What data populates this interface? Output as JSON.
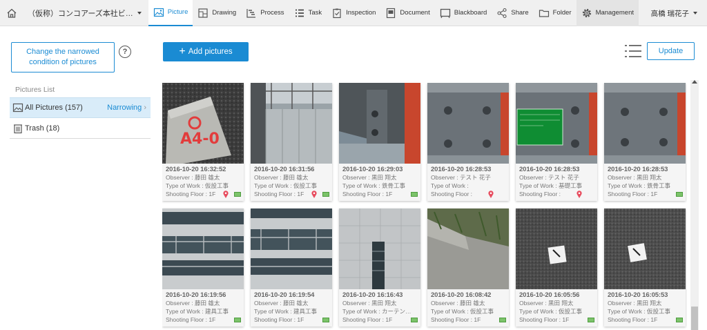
{
  "header": {
    "project_name": "（仮称）コンコアーズ本社ビ…",
    "nav": [
      {
        "label": "Picture",
        "icon": "picture-icon"
      },
      {
        "label": "Drawing",
        "icon": "drawing-icon"
      },
      {
        "label": "Process",
        "icon": "process-icon"
      },
      {
        "label": "Task",
        "icon": "task-icon"
      },
      {
        "label": "Inspection",
        "icon": "inspection-icon"
      },
      {
        "label": "Document",
        "icon": "document-icon"
      },
      {
        "label": "Blackboard",
        "icon": "blackboard-icon"
      },
      {
        "label": "Share",
        "icon": "share-icon"
      },
      {
        "label": "Folder",
        "icon": "folder-icon"
      },
      {
        "label": "Management",
        "icon": "gear-icon"
      }
    ],
    "user_name": "高橋 瑞花子"
  },
  "sidebar": {
    "narrow_button": "Change the narrowed condition of pictures",
    "help": "?",
    "list_title": "Pictures List",
    "all_pictures": "All Pictures (157)",
    "narrowing": "Narrowing",
    "trash": "Trash (18)"
  },
  "toolbar": {
    "add_label": "Add pictures",
    "update_label": "Update"
  },
  "colors": {
    "accent": "#1a8bd3",
    "pin": "#e74c5e",
    "board": "#7cc36a"
  },
  "pictures": [
    {
      "datetime": "2016-10-20 16:32:52",
      "observer": "Observer : 藤田 雄太",
      "work": "Type of Work : 仮設工事",
      "floor": "Shooting Floor : 1F",
      "pin": true,
      "board": true
    },
    {
      "datetime": "2016-10-20 16:31:56",
      "observer": "Observer : 藤田 雄太",
      "work": "Type of Work : 仮設工事",
      "floor": "Shooting Floor : 1F",
      "pin": true,
      "board": true
    },
    {
      "datetime": "2016-10-20 16:29:03",
      "observer": "Observer : 黒田 翔太",
      "work": "Type of Work : 鉄骨工事",
      "floor": "Shooting Floor : 1F",
      "pin": false,
      "board": true
    },
    {
      "datetime": "2016-10-20 16:28:53",
      "observer": "Observer : テスト 花子",
      "work": "Type of Work :",
      "floor": "Shooting Floor :",
      "pin": true,
      "board": false
    },
    {
      "datetime": "2016-10-20 16:28:53",
      "observer": "Observer : テスト 花子",
      "work": "Type of Work : 基礎工事",
      "floor": "Shooting Floor :",
      "pin": true,
      "board": false
    },
    {
      "datetime": "2016-10-20 16:28:53",
      "observer": "Observer : 黒田 翔太",
      "work": "Type of Work : 鉄骨工事",
      "floor": "Shooting Floor : 1F",
      "pin": false,
      "board": true
    },
    {
      "datetime": "2016-10-20 16:19:56",
      "observer": "Observer : 藤田 雄太",
      "work": "Type of Work : 建具工事",
      "floor": "Shooting Floor : 1F",
      "pin": false,
      "board": true
    },
    {
      "datetime": "2016-10-20 16:19:54",
      "observer": "Observer : 藤田 雄太",
      "work": "Type of Work : 建具工事",
      "floor": "Shooting Floor : 1F",
      "pin": false,
      "board": true
    },
    {
      "datetime": "2016-10-20 16:16:43",
      "observer": "Observer : 黒田 翔太",
      "work": "Type of Work : カーテン…",
      "floor": "Shooting Floor : 1F",
      "pin": false,
      "board": true
    },
    {
      "datetime": "2016-10-20 16:08:42",
      "observer": "Observer : 藤田 雄太",
      "work": "Type of Work : 仮設工事",
      "floor": "Shooting Floor : 1F",
      "pin": false,
      "board": true
    },
    {
      "datetime": "2016-10-20 16:05:56",
      "observer": "Observer : 黒田 翔太",
      "work": "Type of Work : 仮設工事",
      "floor": "Shooting Floor : 1F",
      "pin": false,
      "board": true
    },
    {
      "datetime": "2016-10-20 16:05:53",
      "observer": "Observer : 黒田 翔太",
      "work": "Type of Work : 仮設工事",
      "floor": "Shooting Floor : 1F",
      "pin": false,
      "board": true
    }
  ]
}
